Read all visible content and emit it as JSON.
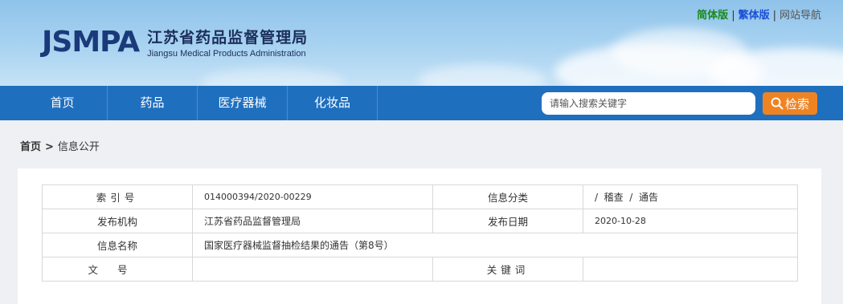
{
  "header": {
    "logo_mark": "JSMPA",
    "logo_cn": "江苏省药品监督管理局",
    "logo_en": "Jiangsu Medical Products Administration",
    "links": [
      "简体版",
      "繁体版",
      "网站导航"
    ],
    "separator": "|"
  },
  "nav": {
    "items": [
      "首页",
      "药品",
      "医疗器械",
      "化妆品"
    ],
    "search_placeholder": "请输入搜索关键字",
    "search_button": "检索"
  },
  "breadcrumb": {
    "home": "首页",
    "arrow": ">",
    "current": "信息公开"
  },
  "info_table": {
    "row1": {
      "label_a": "索引号",
      "value_a": "014000394/2020-00229",
      "label_b": "信息分类",
      "value_b": "/  稽查  /  通告"
    },
    "row2": {
      "label_a": "发布机构",
      "value_a": "江苏省药品监督管理局",
      "label_b": "发布日期",
      "value_b": "2020-10-28"
    },
    "row3": {
      "label_a": "信息名称",
      "value_a": "国家医疗器械监督抽检结果的通告（第8号）"
    },
    "row4": {
      "label_a": "文号",
      "value_a": "",
      "label_b": "关键词",
      "value_b": ""
    }
  },
  "colors": {
    "nav_bg": "#1f6fbf",
    "search_btn": "#f08321",
    "logo": "#1b3a7a"
  }
}
